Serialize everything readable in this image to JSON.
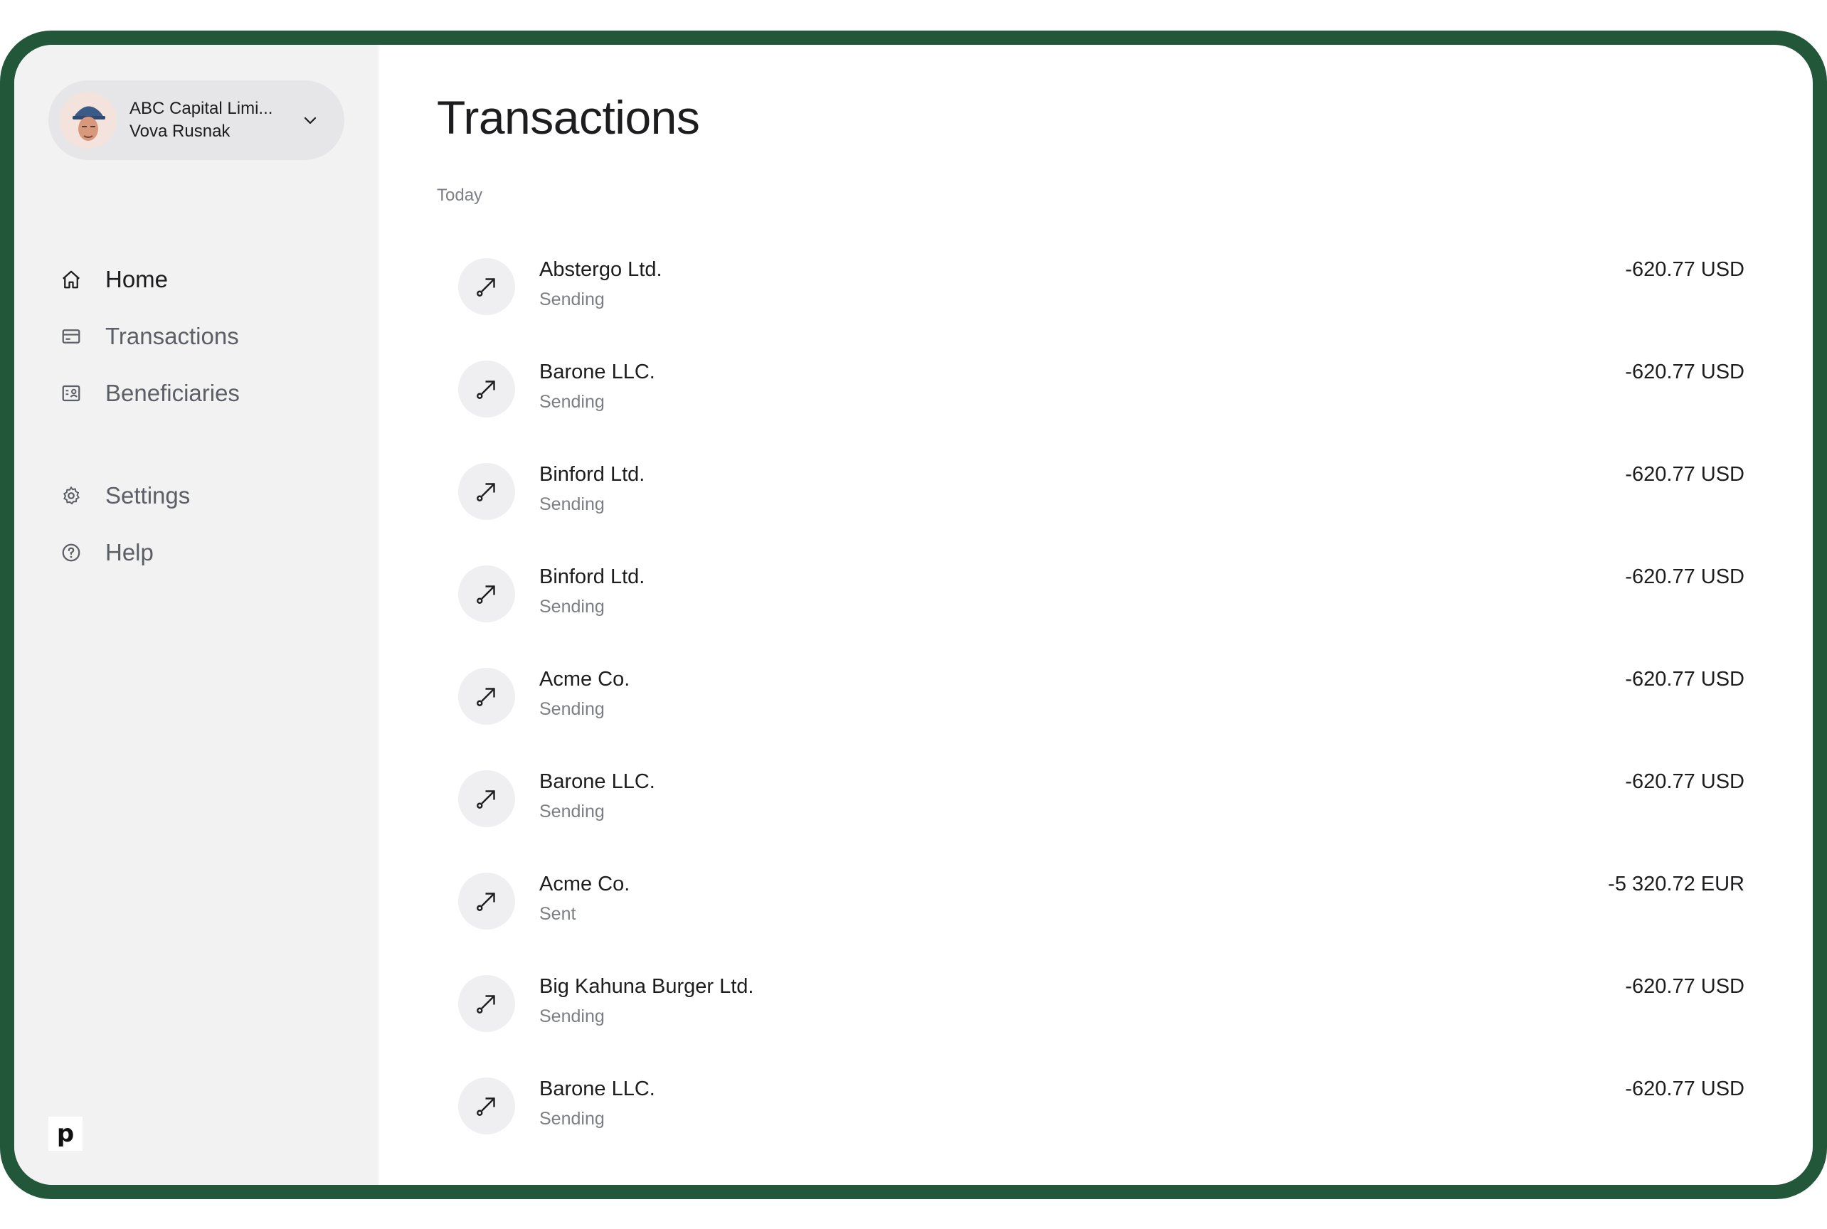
{
  "account": {
    "company": "ABC Capital Limi...",
    "person": "Vova Rusnak"
  },
  "nav": {
    "items": [
      {
        "label": "Home",
        "icon": "home-icon"
      },
      {
        "label": "Transactions",
        "icon": "card-icon"
      },
      {
        "label": "Beneficiaries",
        "icon": "contact-card-icon"
      }
    ],
    "secondary": [
      {
        "label": "Settings",
        "icon": "gear-icon"
      },
      {
        "label": "Help",
        "icon": "help-circle-icon"
      }
    ]
  },
  "brand": {
    "logo": "p"
  },
  "page": {
    "title": "Transactions",
    "section": "Today"
  },
  "transactions": [
    {
      "name": "Abstergo Ltd.",
      "status": "Sending",
      "amount": "-620.77 USD"
    },
    {
      "name": "Barone LLC.",
      "status": "Sending",
      "amount": "-620.77 USD"
    },
    {
      "name": "Binford Ltd.",
      "status": "Sending",
      "amount": "-620.77 USD"
    },
    {
      "name": "Binford Ltd.",
      "status": "Sending",
      "amount": "-620.77 USD"
    },
    {
      "name": "Acme Co.",
      "status": "Sending",
      "amount": "-620.77 USD"
    },
    {
      "name": "Barone LLC.",
      "status": "Sending",
      "amount": "-620.77 USD"
    },
    {
      "name": "Acme Co.",
      "status": "Sent",
      "amount": "-5 320.72 EUR"
    },
    {
      "name": "Big Kahuna Burger Ltd.",
      "status": "Sending",
      "amount": "-620.77 USD"
    },
    {
      "name": "Barone LLC.",
      "status": "Sending",
      "amount": "-620.77 USD"
    }
  ],
  "colors": {
    "frame": "#22573a",
    "sidebar": "#f2f2f3",
    "text": "#1d1d1f",
    "muted": "#7c7e85"
  }
}
